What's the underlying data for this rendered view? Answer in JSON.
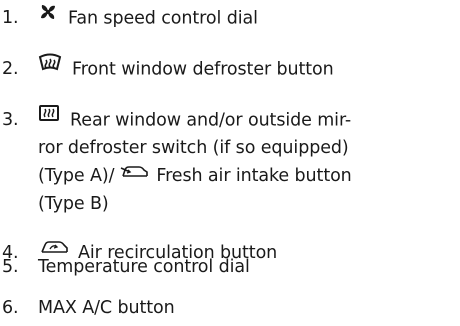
{
  "items": [
    {
      "number": "1.",
      "text": "Fan speed control dial",
      "icon": "fan-icon"
    },
    {
      "number": "2.",
      "text": "Front window defroster button",
      "icon": "front-defroster-icon"
    },
    {
      "number": "3.",
      "icon": "rear-defroster-icon",
      "line1": "Rear window and/or outside mir-",
      "line2": "ror defroster switch (if so equipped)",
      "line3a": "(Type A)/",
      "line3_icon": "fresh-air-intake-icon",
      "line3b": "Fresh air intake button",
      "line4": "(Type B)"
    },
    {
      "number": "4.",
      "text": "Air recirculation button",
      "icon": "recirculation-icon"
    },
    {
      "number": "5.",
      "text": "Temperature control dial"
    },
    {
      "number": "6.",
      "text": "MAX A/C button"
    }
  ]
}
